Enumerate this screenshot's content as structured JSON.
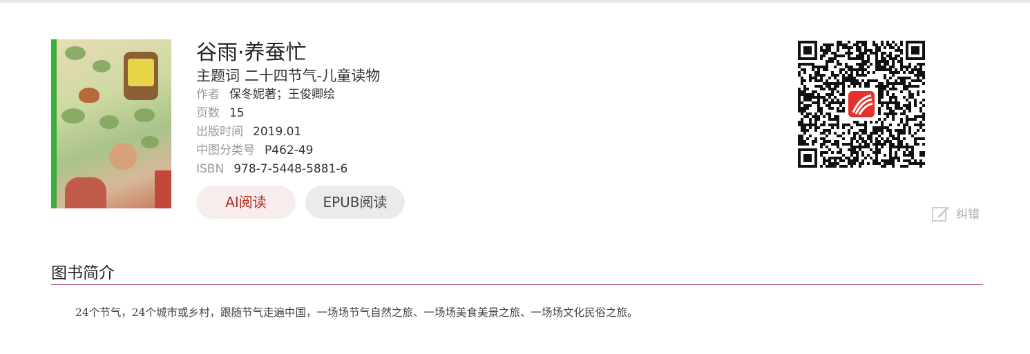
{
  "book": {
    "title": "谷雨·养蚕忙",
    "subject_label": "主题词",
    "subject_value": "二十四节气-儿童读物",
    "meta": [
      {
        "label": "作者",
        "value": "保冬妮著；王俊卿绘"
      },
      {
        "label": "页数",
        "value": "15"
      },
      {
        "label": "出版时间",
        "value": "2019.01"
      },
      {
        "label": "中图分类号",
        "value": "P462-49"
      },
      {
        "label": "ISBN",
        "value": "978-7-5448-5881-6"
      }
    ],
    "buttons": {
      "ai_read": "AI阅读",
      "epub_read": "EPUB阅读"
    },
    "correct_label": "纠错"
  },
  "section": {
    "title": "图书简介",
    "intro": "24个节气，24个城市或乡村，跟随节气走遍中国，一场场节气自然之旅、一场场美食美景之旅、一场场文化民俗之旅。"
  },
  "colors": {
    "accent": "#b5281f",
    "ai_button_bg": "#f8eded",
    "epub_button_bg": "#ebebeb",
    "divider": "#b84a5a",
    "cover_spine": "#3cae3a"
  }
}
